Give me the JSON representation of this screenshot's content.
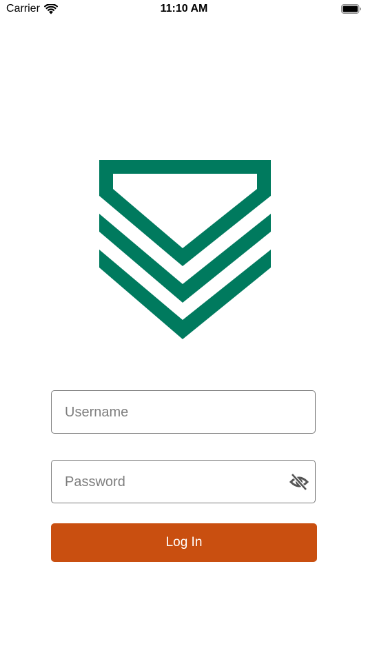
{
  "status_bar": {
    "carrier": "Carrier",
    "time": "11:10 AM",
    "wifi_icon": "wifi-icon",
    "battery_icon": "battery-icon"
  },
  "logo": {
    "icon": "chevron-shield-logo",
    "color": "#007a5e"
  },
  "login_form": {
    "username_placeholder": "Username",
    "password_placeholder": "Password",
    "password_toggle_icon": "eye-off-icon",
    "login_label": "Log In",
    "button_color": "#c94f10"
  }
}
